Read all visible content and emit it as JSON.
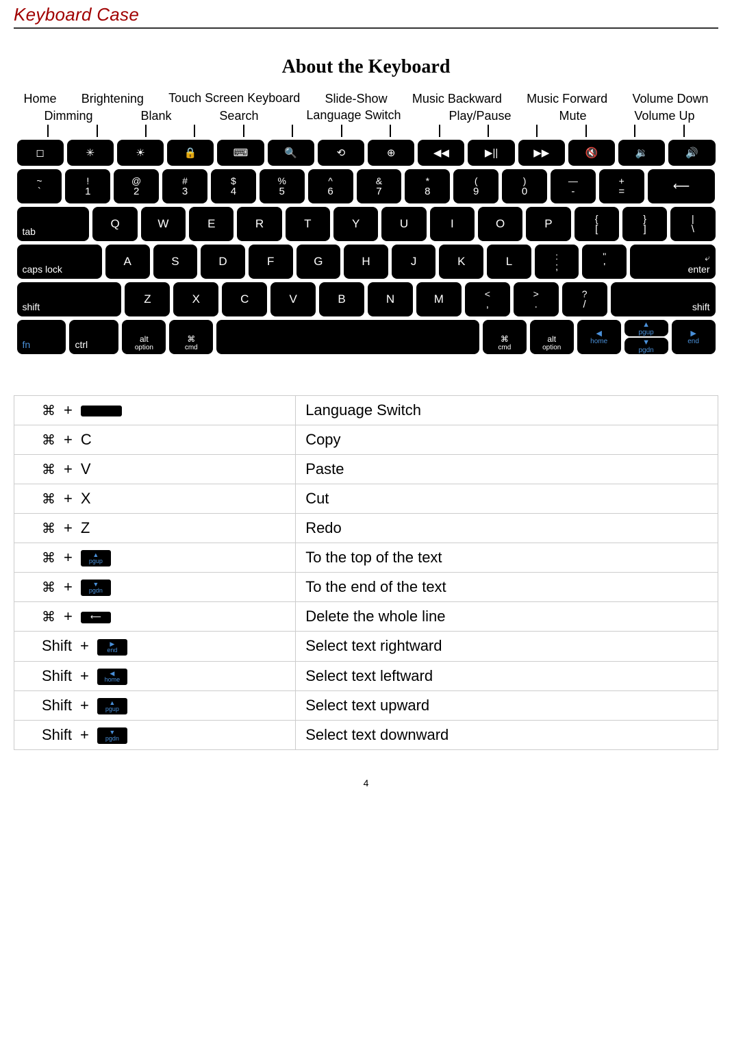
{
  "header": {
    "title": "Keyboard Case"
  },
  "section": {
    "title": "About the Keyboard"
  },
  "topLabels1": [
    "Home",
    "Brightening",
    "Touch Screen Keyboard",
    "Slide-Show",
    "Music Backward",
    "Music Forward",
    "Volume Down"
  ],
  "topLabels2": [
    "Dimming",
    "Blank",
    "Search",
    "Language Switch",
    "Play/Pause",
    "Mute",
    "Volume Up"
  ],
  "fnIcons": [
    "◻",
    "✳",
    "☀",
    "🔒",
    "⌨",
    "🔍",
    "⟲",
    "⊕",
    "◀◀",
    "▶||",
    "▶▶",
    "🔇",
    "🔉",
    "🔊"
  ],
  "row1": [
    {
      "t": "~",
      "b": "`"
    },
    {
      "t": "!",
      "b": "1"
    },
    {
      "t": "@",
      "b": "2"
    },
    {
      "t": "#",
      "b": "3"
    },
    {
      "t": "$",
      "b": "4"
    },
    {
      "t": "%",
      "b": "5"
    },
    {
      "t": "^",
      "b": "6"
    },
    {
      "t": "&",
      "b": "7"
    },
    {
      "t": "*",
      "b": "8"
    },
    {
      "t": "(",
      "b": "9"
    },
    {
      "t": ")",
      "b": "0"
    },
    {
      "t": "—",
      "b": "-"
    },
    {
      "t": "+",
      "b": "="
    }
  ],
  "row1_bksp": "⟵",
  "row2_tab": "tab",
  "row2": [
    "Q",
    "W",
    "E",
    "R",
    "T",
    "Y",
    "U",
    "I",
    "O",
    "P"
  ],
  "row2_end": [
    {
      "t": "{",
      "b": "["
    },
    {
      "t": "}",
      "b": "]"
    },
    {
      "t": "|",
      "b": "\\"
    }
  ],
  "row3_caps": "caps lock",
  "row3": [
    "A",
    "S",
    "D",
    "F",
    "G",
    "H",
    "J",
    "K",
    "L"
  ],
  "row3_end": [
    {
      "t": ":",
      "b": ";"
    },
    {
      "t": "\"",
      "b": "'"
    }
  ],
  "row3_enter_top": "⤶",
  "row3_enter": "enter",
  "row4_shiftL": "shift",
  "row4": [
    "Z",
    "X",
    "C",
    "V",
    "B",
    "N",
    "M"
  ],
  "row4_end": [
    {
      "t": "<",
      "b": ","
    },
    {
      "t": ">",
      "b": "."
    },
    {
      "t": "?",
      "b": "/"
    }
  ],
  "row4_shiftR": "shift",
  "row5": {
    "fn": "fn",
    "ctrl": "ctrl",
    "altL_t": "alt",
    "altL_b": "option",
    "cmdL_t": "⌘",
    "cmdL_b": "cmd",
    "cmdR_t": "⌘",
    "cmdR_b": "cmd",
    "altR_t": "alt",
    "altR_b": "option",
    "pgup_t": "▲",
    "pgup_b": "pgup",
    "pgdn_t": "▼",
    "pgdn_b": "pgdn",
    "home_t": "◀",
    "home_b": "home",
    "end_t": "▶",
    "end_b": "end"
  },
  "shortcuts": [
    {
      "mod": "⌘",
      "plus": "+",
      "key": "space",
      "keyType": "img",
      "desc": "Language Switch"
    },
    {
      "mod": "⌘",
      "plus": "+",
      "key": "C",
      "keyType": "text",
      "desc": "Copy"
    },
    {
      "mod": "⌘",
      "plus": "+",
      "key": "V",
      "keyType": "text",
      "desc": "Paste"
    },
    {
      "mod": "⌘",
      "plus": "+",
      "key": "X",
      "keyType": "text",
      "desc": "Cut"
    },
    {
      "mod": "⌘",
      "plus": "+",
      "key": "Z",
      "keyType": "text",
      "desc": "Redo"
    },
    {
      "mod": "⌘",
      "plus": "+",
      "key": "pgup",
      "keyType": "img",
      "desc": "To the top of the text"
    },
    {
      "mod": "⌘",
      "plus": "+",
      "key": "pgdn",
      "keyType": "img",
      "desc": "To the end of the text"
    },
    {
      "mod": "⌘",
      "plus": "+",
      "key": "bksp",
      "keyType": "img",
      "desc": "Delete the whole line"
    },
    {
      "mod": "Shift",
      "plus": "+",
      "key": "end",
      "keyType": "img",
      "desc": "Select text rightward"
    },
    {
      "mod": "Shift",
      "plus": "+",
      "key": "home",
      "keyType": "img",
      "desc": "Select text leftward"
    },
    {
      "mod": "Shift",
      "plus": "+",
      "key": "pgup",
      "keyType": "img",
      "desc": "Select text upward"
    },
    {
      "mod": "Shift",
      "plus": "+",
      "key": "pgdn",
      "keyType": "img",
      "desc": "Select text downward"
    }
  ],
  "miniKeys": {
    "space": "",
    "pgup": {
      "a": "▲",
      "b": "pgup"
    },
    "pgdn": {
      "a": "▼",
      "b": "pgdn"
    },
    "bksp": "⟵",
    "end": {
      "a": "▶",
      "b": "end"
    },
    "home": {
      "a": "◀",
      "b": "home"
    }
  },
  "pageNum": "4"
}
